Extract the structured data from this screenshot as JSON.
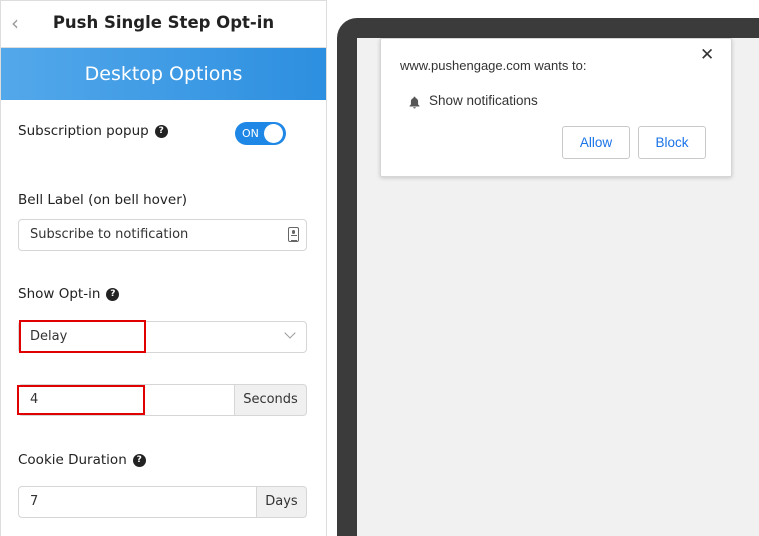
{
  "panel": {
    "title": "Push Single Step Opt-in",
    "back_icon": "chevron-left-icon",
    "section_title": "Desktop Options",
    "accent_color": "#2d8fe0"
  },
  "subscription_popup": {
    "label": "Subscription popup",
    "help": "?",
    "toggle_state": "ON"
  },
  "bell_label": {
    "label": "Bell Label (on bell hover)",
    "value": "Subscribe to notification"
  },
  "show_optin": {
    "label": "Show Opt-in",
    "help": "?",
    "selected": "Delay",
    "delay_value": "4",
    "delay_unit": "Seconds"
  },
  "cookie_duration": {
    "label": "Cookie Duration",
    "help": "?",
    "value": "7",
    "unit": "Days"
  },
  "preview": {
    "site_text": "www.pushengage.com wants to:",
    "permission_item": "Show notifications",
    "allow_label": "Allow",
    "block_label": "Block",
    "close_symbol": "✕",
    "highlight_color": "#e00000"
  }
}
